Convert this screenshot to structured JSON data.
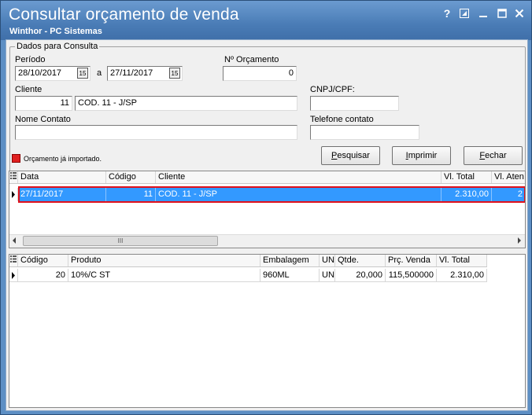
{
  "window": {
    "title": "Consultar orçamento de venda",
    "subtitle": "Winthor - PC Sistemas",
    "help_label": "?"
  },
  "filters": {
    "group_title": "Dados para Consulta",
    "periodo_label": "Período",
    "date_from": "28/10/2017",
    "date_sep": "a",
    "date_to": "27/11/2017",
    "calendar_glyph": "15",
    "orcamento_label": "Nº Orçamento",
    "orcamento_value": "0",
    "cliente_label": "Cliente",
    "cliente_code": "11",
    "cliente_name": "COD. 11 - J/SP",
    "cnpj_label": "CNPJ/CPF:",
    "cnpj_value": "",
    "nome_contato_label": "Nome Contato",
    "nome_contato_value": "",
    "telefone_label": "Telefone contato",
    "telefone_value": "",
    "legend_text": "Orçamento já importado.",
    "legend_color": "#e02020"
  },
  "buttons": {
    "pesquisar_first": "P",
    "pesquisar_rest": "esquisar",
    "imprimir_first": "I",
    "imprimir_rest": "mprimir",
    "fechar_first": "F",
    "fechar_rest": "echar"
  },
  "orcamentos_grid": {
    "columns": [
      "Data",
      "Código",
      "Cliente",
      "Vl. Total",
      "Vl. Aten"
    ],
    "rows": [
      {
        "data": "27/11/2017",
        "codigo": "11",
        "cliente": "COD. 11 - J/SP",
        "vl_total": "2.310,00",
        "vl_aten": "2"
      }
    ],
    "scroll_grip": "III",
    "selection_color": "#3399ff",
    "highlight_color": "#e0101a"
  },
  "itens_grid": {
    "columns": [
      "Código",
      "Produto",
      "Embalagem",
      "UN",
      "Qtde.",
      "Prç. Venda",
      "Vl. Total"
    ],
    "rows": [
      {
        "codigo": "20",
        "produto": "10%/C ST",
        "embalagem": "960ML",
        "un": "UN",
        "qtde": "20,000",
        "prc_venda": "115,500000",
        "vl_total": "2.310,00"
      }
    ]
  }
}
